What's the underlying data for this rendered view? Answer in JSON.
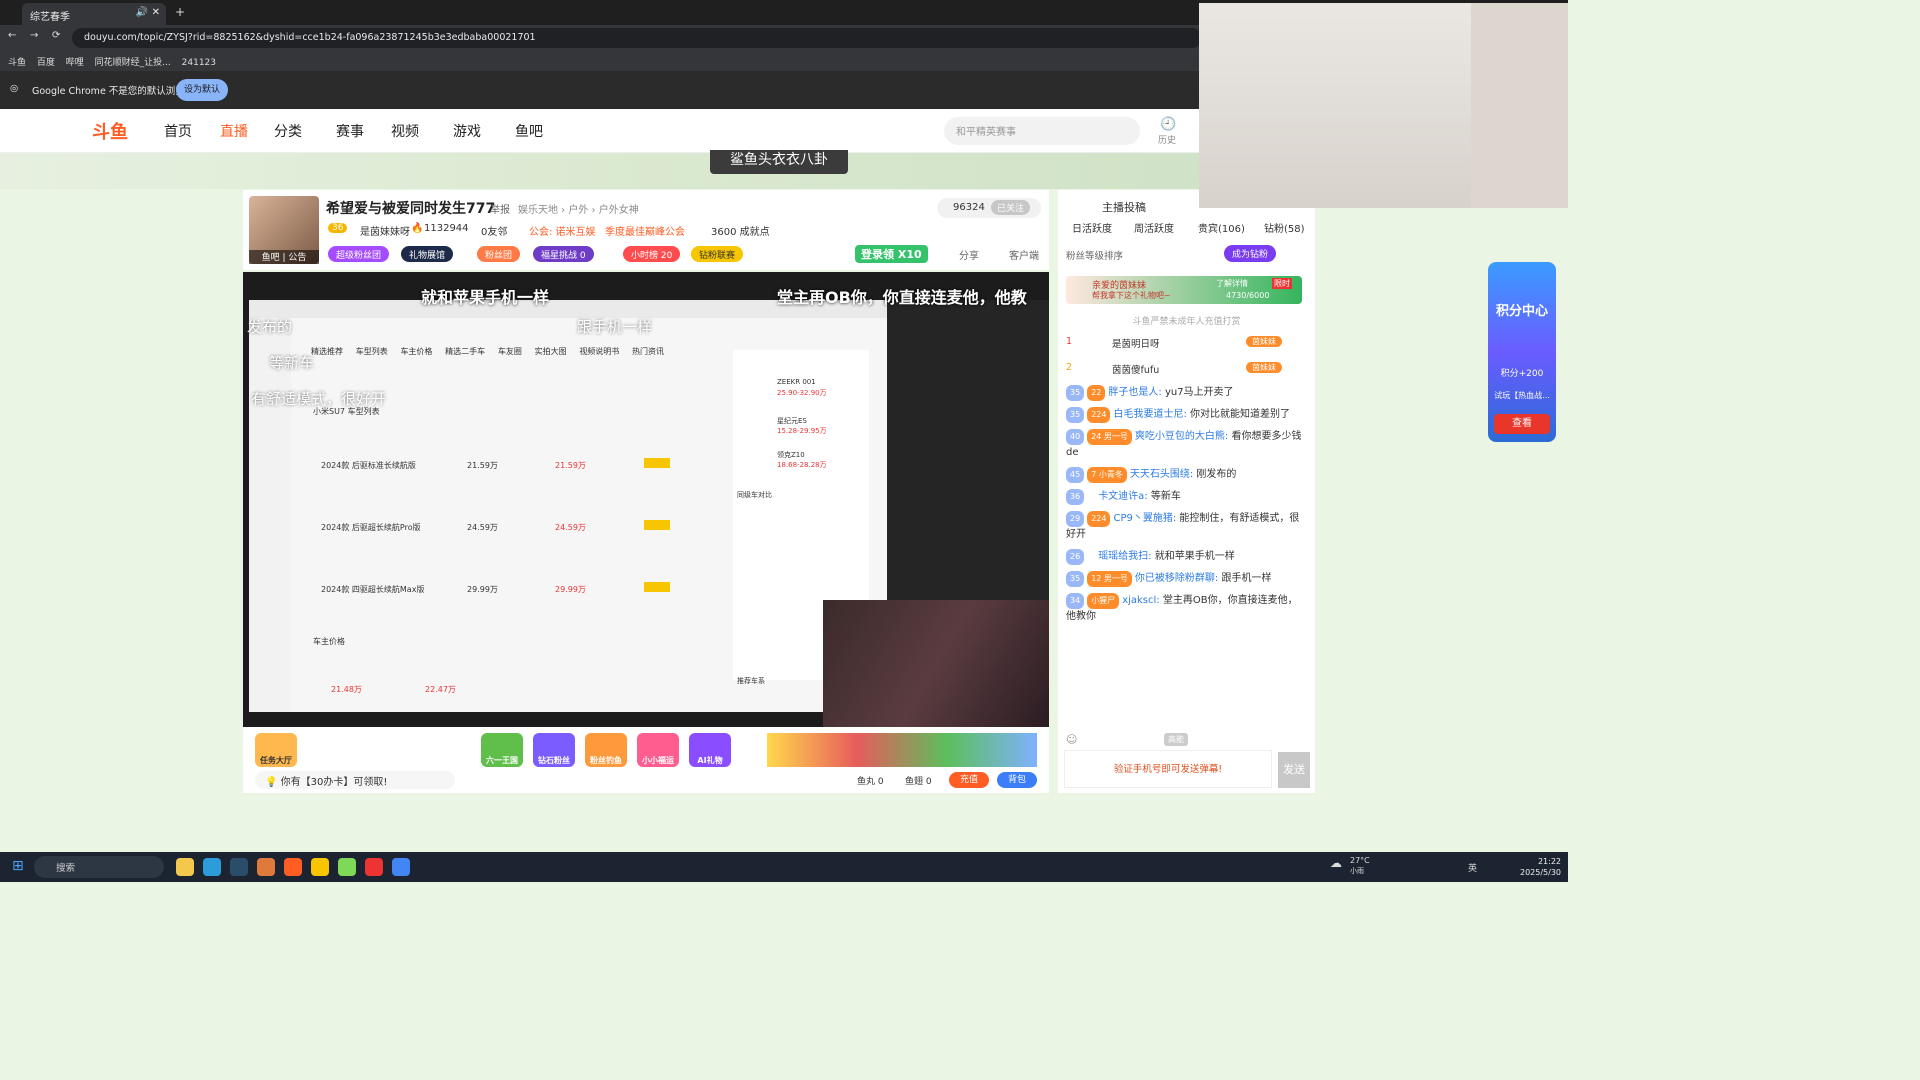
{
  "browser": {
    "tab_title": "综艺春季",
    "url": "douyu.com/topic/ZYSJ?rid=8825162&dyshid=cce1b24-fa096a23871245b3e3edbaba00021701",
    "bookmarks": [
      "斗鱼",
      "百度",
      "哔哩",
      "同花顺财经_让投...",
      "241123"
    ],
    "infobar_text": "Google Chrome 不是您的默认浏览器",
    "infobar_button": "设为默认"
  },
  "site": {
    "logo": "斗鱼",
    "nav": [
      "首页",
      "直播",
      "分类",
      "赛事",
      "视频",
      "游戏",
      "鱼吧"
    ],
    "search_placeholder": "和平精英赛事",
    "history_label": "历史",
    "banner_title": "鲨鱼头衣衣八卦"
  },
  "room": {
    "title": "希望爱与被爱同时发生777",
    "report": "举报",
    "category": "娱乐天地 › 户外 › 户外女神",
    "level": "36",
    "streamer": "是茵妹妹呀",
    "hot": "1132944",
    "friends": "0友邻",
    "guild": "公会: 诺米互娱",
    "guild_tag": "季度最佳巅峰公会",
    "achievements": "3600 成就点",
    "avatar_tag": "鱼吧 | 公告",
    "viewers": "96324",
    "followed": "已关注",
    "tags": [
      "超级粉丝团",
      "礼物展馆",
      "粉丝团",
      "福星挑战 0",
      "小时榜 20",
      "钻粉联赛"
    ],
    "login_prize": "登录领",
    "login_mult": "X10",
    "share": "分享",
    "client": "客户端"
  },
  "video": {
    "subtitle_1": "就和苹果手机一样",
    "subtitle_2": "堂主再OB你，你直接连麦他，他教",
    "ghost_1": "发布的",
    "ghost_2": "跟手机一样",
    "ghost_3": "等新车",
    "ghost_4": "有舒适模式，很好开",
    "screen_title": "小米SU7 车型列表",
    "screen_tabs": [
      "精选推荐",
      "车型列表",
      "车主价格",
      "精选二手车",
      "车友圈",
      "实拍大图",
      "视频说明书",
      "热门资讯"
    ],
    "rows": [
      {
        "name": "2024款 后驱标准长续航版",
        "guide": "21.59万",
        "price": "21.59万"
      },
      {
        "name": "2024款 后驱超长续航Pro版",
        "guide": "24.59万",
        "price": "24.59万"
      },
      {
        "name": "2024款 四驱超长续航Max版",
        "guide": "29.99万",
        "price": "29.99万"
      }
    ],
    "side_cars": [
      {
        "name": "ZEEKR 001",
        "price": "25.90-32.90万"
      },
      {
        "name": "星纪元ES",
        "price": "15.28-29.95万"
      },
      {
        "name": "领克Z10",
        "price": "18.68-28.28万"
      }
    ],
    "compare_title": "同级车对比",
    "recommend_title": "推荐车系",
    "owner_price": "车主价格",
    "promo_price": "21.48万",
    "promo_total": "22.47万"
  },
  "gifts": {
    "task_hall": "任务大厅",
    "items": [
      "六一王国",
      "钻石粉丝",
      "粉丝钓鱼",
      "小小福运",
      "AI礼物"
    ],
    "notice": "你有【30办卡】可领取!",
    "fish_ball": "鱼丸 0",
    "fish_wing": "鱼翅 0",
    "charge": "充值",
    "bag": "背包"
  },
  "right": {
    "vote": "主播投稿",
    "tabs": [
      "日活跃度",
      "周活跃度",
      "贵宾(106)",
      "钻粉(58)"
    ],
    "fans_rank": "粉丝等级排序",
    "become_fan": "成为钻粉",
    "promo_text": "亲爱的茵妹妹",
    "promo_sub": "帮我拿下这个礼物吧~",
    "promo_more": "了解详情",
    "promo_limit": "限时",
    "promo_progress": "4730/6000",
    "minor_notice": "斗鱼严禁未成年人充值打赏",
    "rank": [
      {
        "no": "1",
        "name": "是茵明日呀",
        "tag": "茵妹妹"
      },
      {
        "no": "2",
        "name": "茵茵傻fufu",
        "tag": "茵妹妹"
      }
    ],
    "chat": [
      {
        "lvl": "35",
        "badge": "22",
        "user": "胖子也是人:",
        "msg": "yu7马上开卖了"
      },
      {
        "lvl": "35",
        "badge": "224",
        "user": "白毛我要道士尼:",
        "msg": "你对比就能知道差别了"
      },
      {
        "lvl": "40",
        "badge": "24 男一号",
        "user": "爽吃小豆包的大白熊:",
        "msg": "看你想要多少钱de"
      },
      {
        "lvl": "45",
        "badge": "7 小青冬",
        "user": "天天石头围绕:",
        "msg": "刚发布的"
      },
      {
        "lvl": "36",
        "badge": "",
        "user": "卡文迪许a:",
        "msg": "等新车"
      },
      {
        "lvl": "29",
        "badge": "224",
        "user": "CP9丶翼施猪:",
        "msg": "能控制住，有舒适模式，很好开"
      },
      {
        "lvl": "26",
        "badge": "",
        "user": "瑶瑶给我扫:",
        "msg": "就和苹果手机一样"
      },
      {
        "lvl": "35",
        "badge": "12 男一号",
        "user": "你已被移除粉群聊:",
        "msg": "跟手机一样"
      },
      {
        "lvl": "34",
        "badge": "小猩尸",
        "user": "xjakscl:",
        "msg": "堂主再OB你，你直接连麦他，他教你"
      }
    ],
    "input_placeholder": "验证手机号即可发送弹幕!",
    "send": "发送",
    "tool_hd": "高能"
  },
  "overlay": {
    "points_center": "积分中心",
    "points": "积分+200",
    "event": "试玩【热血战...",
    "view": "查看"
  },
  "taskbar": {
    "search": "搜索",
    "weather": "27°C",
    "weather_desc": "小雨",
    "lang": "英",
    "time": "21:22",
    "date": "2025/5/30"
  },
  "colors": {
    "brand": "#ff5d23",
    "accent": "#3b7ef7"
  }
}
